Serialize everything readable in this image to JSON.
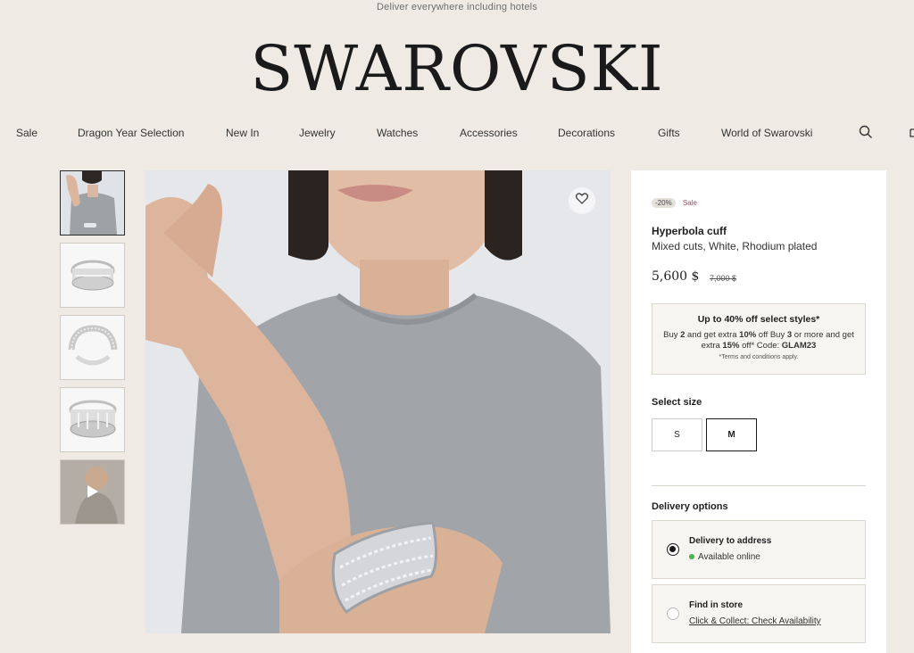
{
  "banner": "Deliver everywhere including hotels",
  "logo": "SWAROVSKI",
  "nav": {
    "items": [
      "Sale",
      "Dragon Year Selection",
      "New In",
      "Jewelry",
      "Watches",
      "Accessories",
      "Decorations",
      "Gifts",
      "World of Swarovski"
    ],
    "search_icon": "search-icon",
    "cart_icon": "bag-icon"
  },
  "gallery": {
    "thumbnails": [
      "model-wearing-cuff",
      "cuff-front-view",
      "cuff-side-view",
      "cuff-top-view",
      "video"
    ],
    "play_icon": "play-icon",
    "wishlist_icon": "heart-icon"
  },
  "product": {
    "discount": "-20%",
    "sale": "Sale",
    "name": "Hyperbola cuff",
    "subtitle": "Mixed cuts, White, Rhodium plated",
    "price": "5,600 $",
    "old_price": "7,000 $"
  },
  "promo": {
    "title": "Up to 40% off select styles*",
    "line_parts": [
      "Buy ",
      "2",
      " and get extra ",
      "10%",
      " off Buy ",
      "3",
      " or more and get extra ",
      "15%",
      " off* Code: ",
      "GLAM23"
    ],
    "terms": "*Terms and conditions apply."
  },
  "size": {
    "label": "Select size",
    "options": [
      "S",
      "M"
    ],
    "selected": "M"
  },
  "delivery": {
    "label": "Delivery options",
    "options": [
      {
        "title": "Delivery to address",
        "sub": "Available online",
        "selected": true
      },
      {
        "title": "Find in store",
        "sub": "Click & Collect: Check Availability",
        "selected": false
      }
    ]
  },
  "colors": {
    "background": "#efebe4",
    "sale": "#b0405a",
    "available": "#4caf50"
  }
}
